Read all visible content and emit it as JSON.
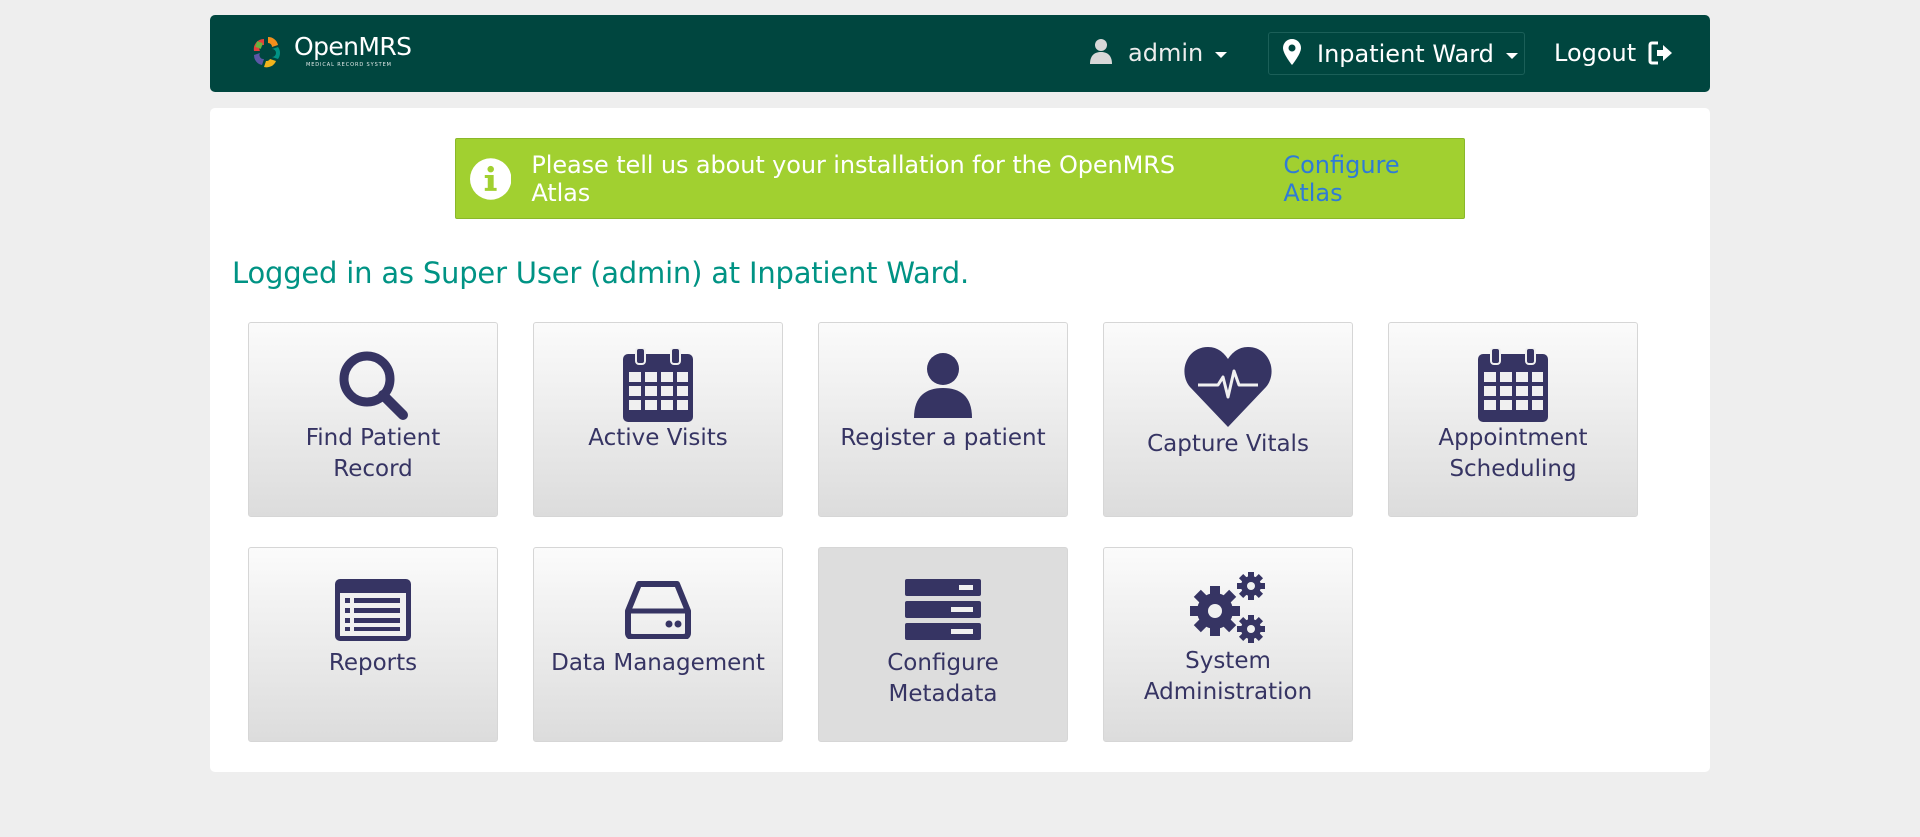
{
  "header": {
    "logo_name": "OpenMRS",
    "logo_tagline": "MEDICAL RECORD SYSTEM",
    "user": "admin",
    "location": "Inpatient Ward",
    "logout_label": "Logout",
    "bg_color": "#00463f"
  },
  "alert": {
    "message": "Please tell us about your installation for the OpenMRS Atlas",
    "link_label": "Configure Atlas",
    "icon": "info-circle-icon",
    "bg_color": "#a1d030"
  },
  "greeting": "Logged in as Super User (admin) at Inpatient Ward.",
  "apps": [
    {
      "label": "Find Patient Record",
      "icon": "search-icon"
    },
    {
      "label": "Active Visits",
      "icon": "calendar-icon"
    },
    {
      "label": "Register a patient",
      "icon": "user-icon"
    },
    {
      "label": "Capture Vitals",
      "icon": "heartbeat-icon"
    },
    {
      "label": "Appointment Scheduling",
      "icon": "calendar-icon"
    },
    {
      "label": "Reports",
      "icon": "list-alt-icon"
    },
    {
      "label": "Data Management",
      "icon": "hdd-icon"
    },
    {
      "label": "Configure Metadata",
      "icon": "server-icon"
    },
    {
      "label": "System Administration",
      "icon": "gears-icon"
    }
  ],
  "colors": {
    "accent_text": "#009384",
    "tile_text": "#363463",
    "link": "#2f7bd6"
  }
}
